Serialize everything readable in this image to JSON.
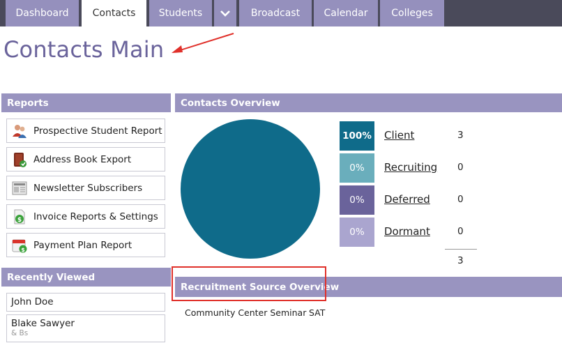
{
  "nav": {
    "tabs": [
      {
        "label": "Dashboard"
      },
      {
        "label": "Contacts"
      },
      {
        "label": "Students"
      },
      {
        "label": "Broadcast"
      },
      {
        "label": "Calendar"
      },
      {
        "label": "Colleges"
      }
    ],
    "dropdown_icon": "chevron-down-icon"
  },
  "page": {
    "title": "Contacts Main"
  },
  "reports": {
    "title": "Reports",
    "items": [
      {
        "label": "Prospective Student Report",
        "icon": "users-icon"
      },
      {
        "label": "Address Book Export",
        "icon": "address-book-icon"
      },
      {
        "label": "Newsletter Subscribers",
        "icon": "newspaper-icon"
      },
      {
        "label": "Invoice Reports & Settings",
        "icon": "invoice-icon"
      },
      {
        "label": "Payment Plan Report",
        "icon": "calendar-payment-icon"
      }
    ]
  },
  "recently_viewed": {
    "title": "Recently Viewed",
    "items": [
      {
        "name": "John Doe"
      },
      {
        "name": "Blake Sawyer",
        "sub": "& Bs"
      }
    ]
  },
  "overview": {
    "title": "Contacts Overview",
    "rows": [
      {
        "pct": "100%",
        "label": "Client",
        "count": "3",
        "color": "#0f6b8a"
      },
      {
        "pct": "0%",
        "label": "Recruiting",
        "count": "0",
        "color": "#6aaebc"
      },
      {
        "pct": "0%",
        "label": "Deferred",
        "count": "0",
        "color": "#6a639b"
      },
      {
        "pct": "0%",
        "label": "Dormant",
        "count": "0",
        "color": "#aaa5cf"
      }
    ],
    "total": "3",
    "pie_color": "#0f6b8a"
  },
  "recruitment": {
    "title": "Recruitment Source Overview",
    "sources": [
      "Community Center Seminar",
      "SAT"
    ]
  },
  "colors": {
    "nav_bg": "#4a4a5a",
    "tab_bg": "#9590bd",
    "panel_header": "#9994c0",
    "title_color": "#6a639b",
    "annotation_red": "#e0302a"
  }
}
